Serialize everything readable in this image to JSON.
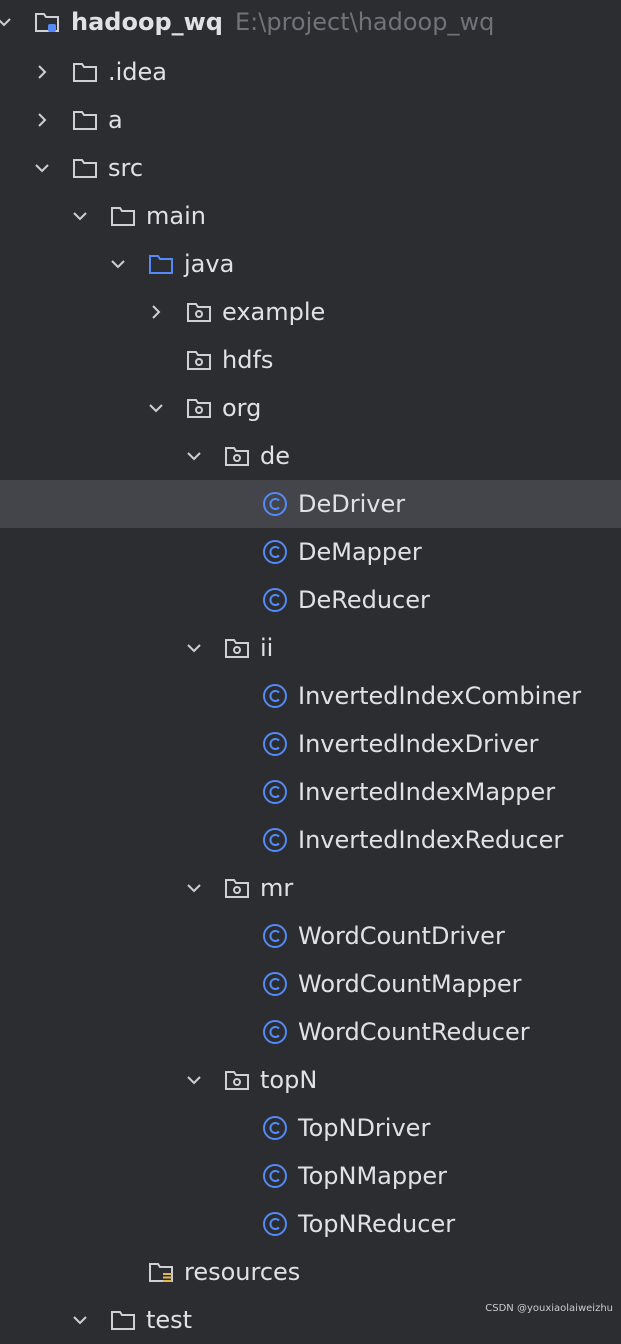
{
  "project": {
    "name": "hadoop_wq",
    "path": "E:\\project\\hadoop_wq"
  },
  "tree": {
    "idea": ".idea",
    "a": "a",
    "src": "src",
    "main": "main",
    "java": "java",
    "example": "example",
    "hdfs": "hdfs",
    "org": "org",
    "de": "de",
    "de_driver": "DeDriver",
    "de_mapper": "DeMapper",
    "de_reducer": "DeReducer",
    "ii": "ii",
    "ii_combiner": "InvertedIndexCombiner",
    "ii_driver": "InvertedIndexDriver",
    "ii_mapper": "InvertedIndexMapper",
    "ii_reducer": "InvertedIndexReducer",
    "mr": "mr",
    "mr_driver": "WordCountDriver",
    "mr_mapper": "WordCountMapper",
    "mr_reducer": "WordCountReducer",
    "topn": "topN",
    "topn_driver": "TopNDriver",
    "topn_mapper": "TopNMapper",
    "topn_reducer": "TopNReducer",
    "resources": "resources",
    "test": "test"
  },
  "watermark": "CSDN @youxiaolaiweizhu",
  "colors": {
    "background": "#2b2d30",
    "selected_row": "#43454a",
    "text": "#dfe1e5",
    "path_text": "#6f737a",
    "class_icon": "#548af7",
    "java_folder": "#548af7"
  }
}
